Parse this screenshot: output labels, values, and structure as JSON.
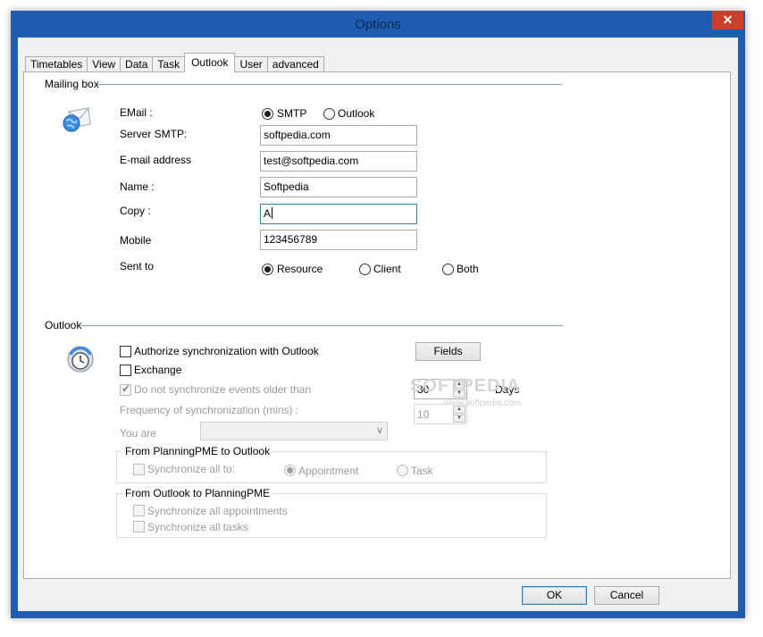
{
  "window": {
    "title": "Options",
    "close_glyph": "✕"
  },
  "tabs": [
    {
      "label": "Timetables",
      "active": false
    },
    {
      "label": "View",
      "active": false
    },
    {
      "label": "Data",
      "active": false
    },
    {
      "label": "Task",
      "active": false
    },
    {
      "label": "Outlook",
      "active": true
    },
    {
      "label": "User",
      "active": false
    },
    {
      "label": "advanced",
      "active": false
    }
  ],
  "mailing_box": {
    "heading": "Mailing box",
    "icon": "envelope-globe-icon",
    "email_label": "EMail :",
    "email_options": [
      {
        "label": "SMTP",
        "selected": true
      },
      {
        "label": "Outlook",
        "selected": false
      }
    ],
    "server_smtp": {
      "label": "Server SMTP:",
      "value": "softpedia.com"
    },
    "email_address": {
      "label": "E-mail address",
      "value": "test@softpedia.com"
    },
    "name": {
      "label": "Name :",
      "value": "Softpedia"
    },
    "copy": {
      "label": "Copy :",
      "value": "A"
    },
    "mobile": {
      "label": "Mobile",
      "value": "123456789"
    },
    "sent_to": {
      "label": "Sent to",
      "options": [
        {
          "label": "Resource",
          "selected": true
        },
        {
          "label": "Client",
          "selected": false
        },
        {
          "label": "Both",
          "selected": false
        }
      ]
    }
  },
  "outlook": {
    "heading": "Outlook",
    "icon": "clock-sync-icon",
    "authorize_sync": {
      "label": "Authorize synchronization with Outlook",
      "checked": false
    },
    "exchange": {
      "label": "Exchange",
      "checked": false
    },
    "no_sync_older": {
      "label": "Do not synchronize events older than",
      "checked": true
    },
    "fields_button": "Fields",
    "days_value": "30",
    "days_label": "Days",
    "frequency": {
      "label": "Frequency of synchronization (mins) :",
      "value": "10"
    },
    "you_are": {
      "label": "You are",
      "value": ""
    },
    "from_planning": {
      "title": "From PlanningPME to Outlook",
      "sync_all_to": {
        "label": "Synchronize all to:",
        "checked": false
      },
      "options": [
        {
          "label": "Appointment",
          "selected": true
        },
        {
          "label": "Task",
          "selected": false
        }
      ]
    },
    "from_outlook": {
      "title": "From Outlook to PlanningPME",
      "sync_appointments": {
        "label": "Synchronize all appointments",
        "checked": false
      },
      "sync_tasks": {
        "label": "Synchronize all tasks",
        "checked": false
      }
    }
  },
  "watermark": {
    "text": "SOFTPEDIA",
    "url": "www.softpedia.com"
  },
  "footer": {
    "ok_label": "OK",
    "cancel_label": "Cancel"
  },
  "colors": {
    "frame": "#1f5db0",
    "close": "#c7402b",
    "separator": "#7da2ce"
  }
}
